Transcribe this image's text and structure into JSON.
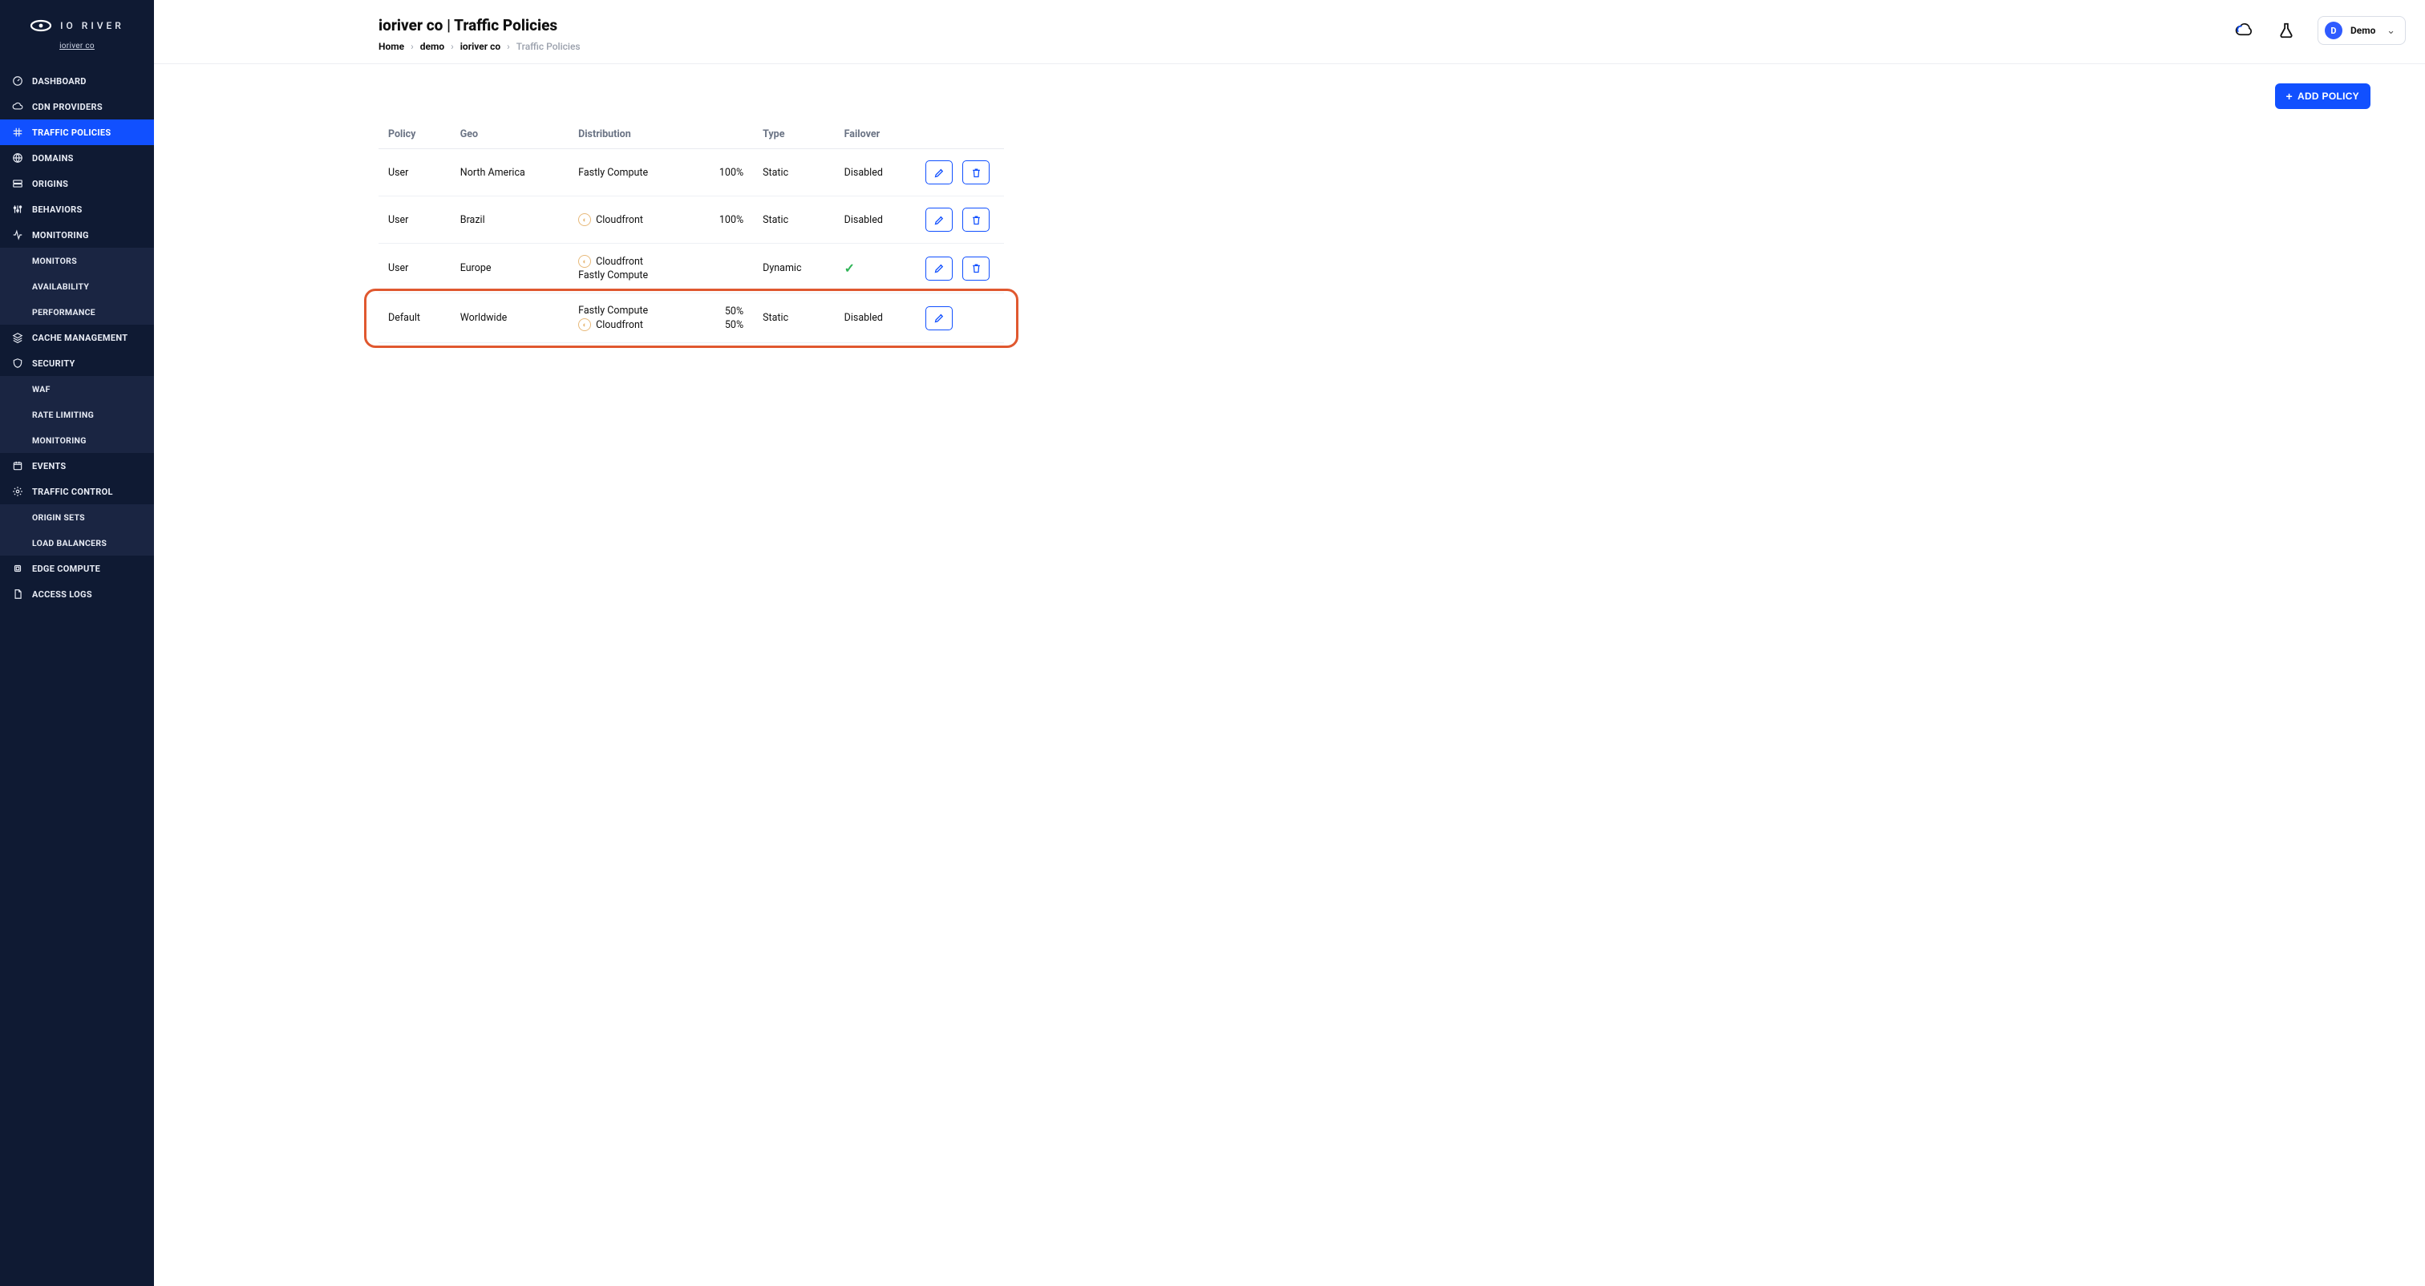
{
  "brand": {
    "name": "IO RIVER",
    "subtitle": "ioriver co"
  },
  "sidebar": {
    "items": [
      {
        "label": "DASHBOARD"
      },
      {
        "label": "CDN PROVIDERS"
      },
      {
        "label": "TRAFFIC POLICIES"
      },
      {
        "label": "DOMAINS"
      },
      {
        "label": "ORIGINS"
      },
      {
        "label": "BEHAVIORS"
      },
      {
        "label": "MONITORING"
      },
      {
        "label": "MONITORS"
      },
      {
        "label": "AVAILABILITY"
      },
      {
        "label": "PERFORMANCE"
      },
      {
        "label": "CACHE MANAGEMENT"
      },
      {
        "label": "SECURITY"
      },
      {
        "label": "WAF"
      },
      {
        "label": "RATE LIMITING"
      },
      {
        "label": "MONITORING"
      },
      {
        "label": "EVENTS"
      },
      {
        "label": "TRAFFIC CONTROL"
      },
      {
        "label": "ORIGIN SETS"
      },
      {
        "label": "LOAD BALANCERS"
      },
      {
        "label": "EDGE COMPUTE"
      },
      {
        "label": "ACCESS LOGS"
      }
    ]
  },
  "header": {
    "title": "ioriver co | Traffic Policies",
    "crumbs": [
      "Home",
      "demo",
      "ioriver co",
      "Traffic Policies"
    ],
    "user": {
      "initial": "D",
      "name": "Demo"
    }
  },
  "toolbar": {
    "add_policy": "ADD POLICY"
  },
  "table": {
    "columns": {
      "policy": "Policy",
      "geo": "Geo",
      "distribution": "Distribution",
      "type": "Type",
      "failover": "Failover"
    },
    "rows": [
      {
        "policy": "User",
        "geo": "North America",
        "dist": [
          {
            "name": "Fastly Compute",
            "icon": false
          }
        ],
        "pct": [
          "100%"
        ],
        "type": "Static",
        "failover": "Disabled",
        "failover_ok": false,
        "has_delete": true
      },
      {
        "policy": "User",
        "geo": "Brazil",
        "dist": [
          {
            "name": "Cloudfront",
            "icon": true
          }
        ],
        "pct": [
          "100%"
        ],
        "type": "Static",
        "failover": "Disabled",
        "failover_ok": false,
        "has_delete": true
      },
      {
        "policy": "User",
        "geo": "Europe",
        "dist": [
          {
            "name": "Cloudfront",
            "icon": true
          },
          {
            "name": "Fastly Compute",
            "icon": false
          }
        ],
        "pct": [],
        "type": "Dynamic",
        "failover": "",
        "failover_ok": true,
        "has_delete": true
      },
      {
        "policy": "Default",
        "geo": "Worldwide",
        "dist": [
          {
            "name": "Fastly Compute",
            "icon": false
          },
          {
            "name": "Cloudfront",
            "icon": true
          }
        ],
        "pct": [
          "50%",
          "50%"
        ],
        "type": "Static",
        "failover": "Disabled",
        "failover_ok": false,
        "has_delete": false,
        "highlight": true
      }
    ]
  }
}
